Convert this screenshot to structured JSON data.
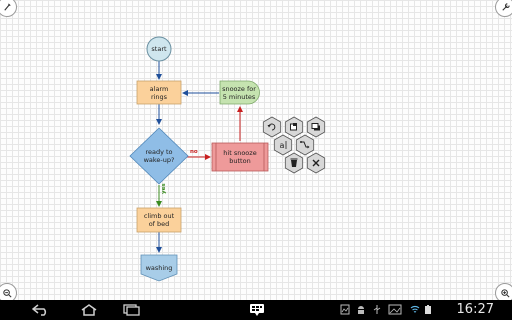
{
  "flowchart": {
    "start": "start",
    "alarm_line1": "alarm",
    "alarm_line2": "rings",
    "snooze_line1": "snooze for",
    "snooze_line2": "5 minutes",
    "decision_line1": "ready to",
    "decision_line2": "wake-up?",
    "hit_line1": "hit snooze",
    "hit_line2": "button",
    "climb_line1": "climb out",
    "climb_line2": "of bed",
    "washing": "washing",
    "no_label": "no",
    "yes_label": "yes"
  },
  "palette": {
    "tools": [
      "rotate-icon",
      "fill-icon",
      "shadow-icon",
      "text-icon",
      "connect-icon",
      "delete-icon",
      "close-icon"
    ]
  },
  "status": {
    "time": "16:27"
  },
  "colors": {
    "start_fill": "#cfe6ee",
    "process_fill": "#fbd19b",
    "snooze_fill": "#c5e3b0",
    "decision_fill": "#8fbde6",
    "hit_fill": "#ee9a9a",
    "washing_fill": "#a8cde8",
    "no_color": "#c82020",
    "yes_color": "#3a8a20",
    "arrow_color": "#1f4f9a"
  }
}
